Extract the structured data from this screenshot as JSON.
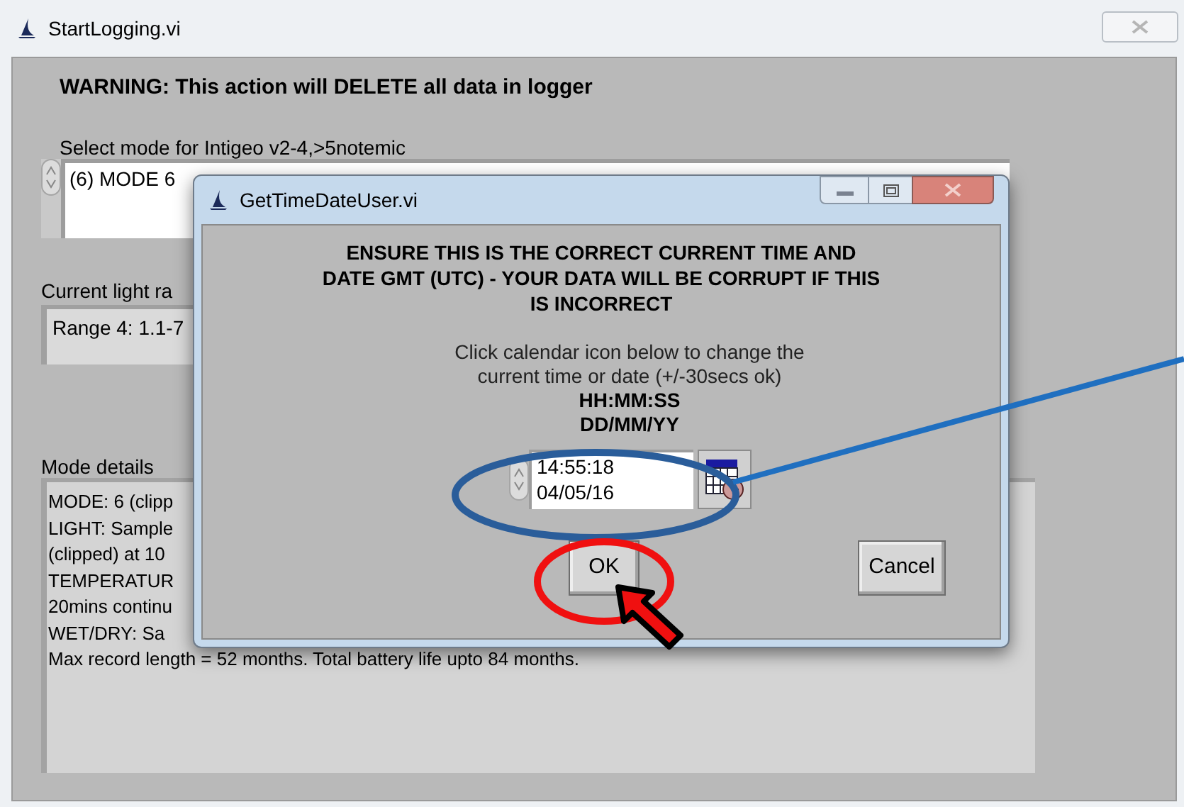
{
  "main_window": {
    "title": "StartLogging.vi",
    "warning": "WARNING: This action will DELETE all data in logger",
    "mode_label": "Select mode for Intigeo v2-4,>5notemic",
    "mode_value": "(6) MODE 6",
    "light_range_label": "Current light ra",
    "light_range_value": "Range 4: 1.1-7",
    "details_label": "Mode details",
    "details_lines": [
      "MODE: 6 (clipp",
      "LIGHT: Sample",
      "(clipped) at 10",
      "TEMPERATUR",
      "20mins continu",
      "WET/DRY: Sa",
      "Max record length = 52 months. Total battery life upto 84 months."
    ]
  },
  "dialog": {
    "title": "GetTimeDateUser.vi",
    "warning_lines": [
      "ENSURE THIS IS THE CORRECT CURRENT TIME AND",
      "DATE GMT (UTC) - YOUR DATA WILL BE CORRUPT IF THIS",
      "IS INCORRECT"
    ],
    "instruction_lines": [
      "Click calendar icon below to change the",
      "current time or date (+/-30secs ok)"
    ],
    "format_lines": [
      "HH:MM:SS",
      "DD/MM/YY"
    ],
    "time_value": "14:55:18",
    "date_value": "04/05/16",
    "buttons": [
      "OK",
      "Cancel"
    ]
  }
}
